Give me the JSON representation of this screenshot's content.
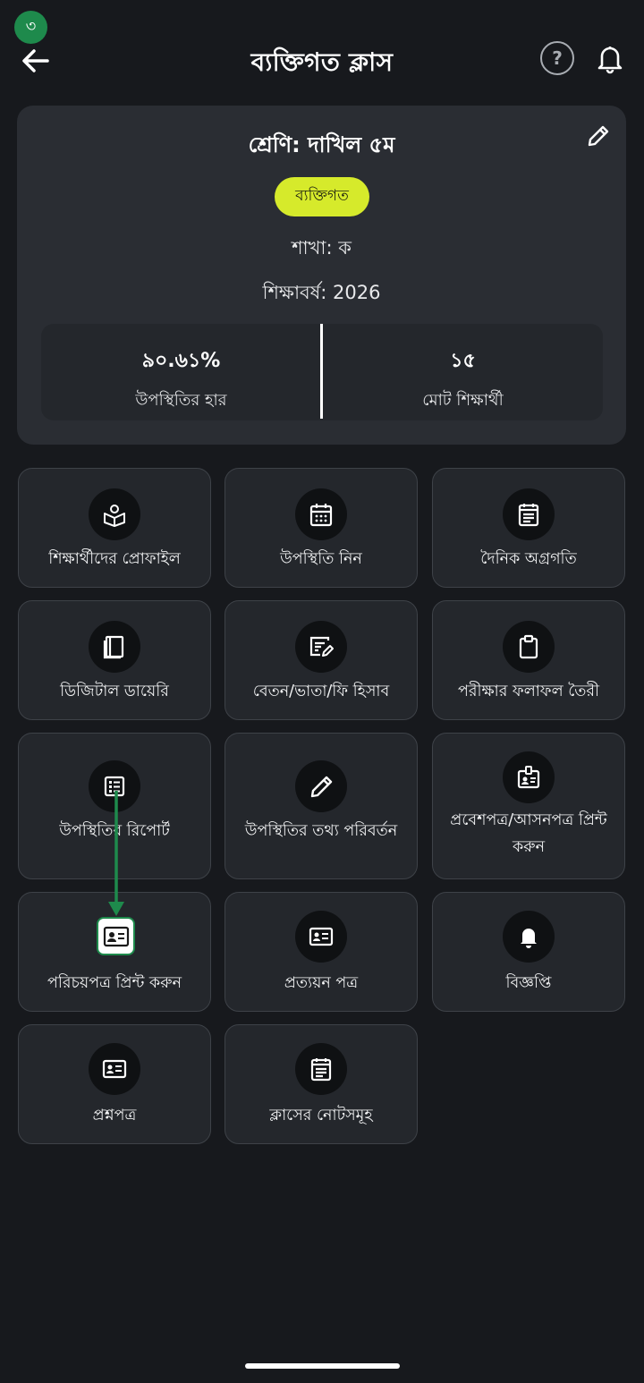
{
  "step_badge": "৩",
  "header": {
    "title": "ব্যক্তিগত ক্লাস",
    "help_label": "?"
  },
  "class_card": {
    "class_name": "শ্রেণি: দাখিল ৫ম",
    "type_badge": "ব্যক্তিগত",
    "section": "শাখা: ক",
    "academic_year": "শিক্ষাবর্ষ: 2026",
    "stats": {
      "attendance_rate_value": "৯০.৬১%",
      "attendance_rate_label": "উপস্থিতির হার",
      "total_students_value": "১৫",
      "total_students_label": "মোট শিক্ষার্থী"
    }
  },
  "menu": {
    "items": [
      {
        "label": "শিক্ষার্থীদের প্রোফাইল",
        "icon": "student-reading-icon"
      },
      {
        "label": "উপস্থিতি নিন",
        "icon": "calendar-icon"
      },
      {
        "label": "দৈনিক অগ্রগতি",
        "icon": "daily-progress-icon"
      },
      {
        "label": "ডিজিটাল ডায়েরি",
        "icon": "book-icon"
      },
      {
        "label": "বেতন/ভাতা/ফি হিসাব",
        "icon": "fee-edit-icon"
      },
      {
        "label": "পরীক্ষার ফলাফল তৈরী",
        "icon": "clipboard-icon"
      },
      {
        "label": "উপস্থিতির রিপোর্ট",
        "icon": "report-list-icon"
      },
      {
        "label": "উপস্থিতির তথ্য পরিবর্তন",
        "icon": "pencil-icon"
      },
      {
        "label": "প্রবেশপত্র/আসনপত্র প্রিন্ট করুন",
        "icon": "badge-id-icon"
      },
      {
        "label": "পরিচয়পত্র প্রিন্ট করুন",
        "icon": "id-card-icon"
      },
      {
        "label": "প্রত্যয়ন পত্র",
        "icon": "certificate-card-icon"
      },
      {
        "label": "বিজ্ঞপ্তি",
        "icon": "bell-icon"
      },
      {
        "label": "প্রশ্নপত্র",
        "icon": "question-paper-icon"
      },
      {
        "label": "ক্লাসের নোটসমূহ",
        "icon": "notes-icon"
      }
    ]
  },
  "colors": {
    "background": "#17191d",
    "card": "#2a2d33",
    "tile": "#24272c",
    "badge_yellow": "#d6ea2b",
    "annotation_green": "#1e8a4c"
  }
}
